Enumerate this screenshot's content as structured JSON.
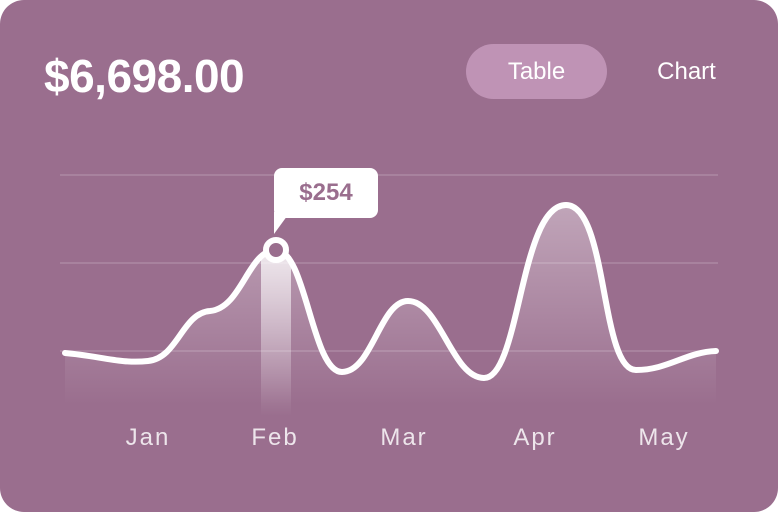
{
  "header": {
    "total": "$6,698.00"
  },
  "view_toggle": {
    "table_label": "Table",
    "chart_label": "Chart",
    "selected": "Table"
  },
  "chart_data": {
    "type": "line",
    "categories": [
      "Jan",
      "Feb",
      "Mar",
      "Apr",
      "May"
    ],
    "highlight": {
      "category": "Feb",
      "label": "$254"
    },
    "grid": true,
    "colors": {
      "background": "#9a6e8e",
      "line": "#ffffff",
      "toggle_active": "#bf93b5"
    }
  }
}
